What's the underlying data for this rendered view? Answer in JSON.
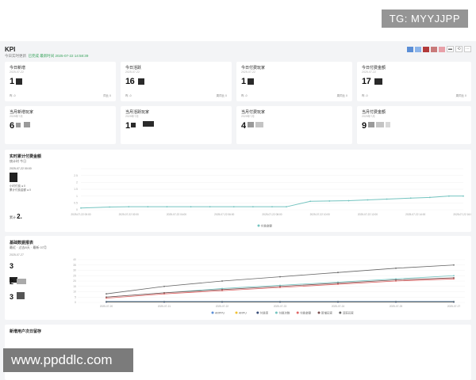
{
  "watermarks": {
    "telegram": "TG: MYYJJPP",
    "site": "www.ppddlc.com"
  },
  "header": {
    "title": "KPI",
    "subtitle_prefix": "今日实时更新",
    "status": "已完成",
    "updated_label": "最新时间 2025-07-22 14:58:39",
    "palette": [
      "#5b8ed6",
      "#8bb4ea",
      "#b23a3a",
      "#c97a7a",
      "#e8a0a8"
    ]
  },
  "kpi_cards": [
    {
      "title": "今日新增",
      "date": "2025-07-22",
      "value": "1",
      "foot_left": "昨 -0",
      "foot_right": "同比 0"
    },
    {
      "title": "今日活跃",
      "date": "2025-07-22",
      "value": "16",
      "foot_left": "昨 -0",
      "foot_right": "周同比 0"
    },
    {
      "title": "今日付费玩家",
      "date": "2025-07-22",
      "value": "1",
      "foot_left": "昨 -0",
      "foot_right": "周同比 0"
    },
    {
      "title": "今日付费金额",
      "date": "2025-07-22",
      "value": "17",
      "foot_left": "昨 -0",
      "foot_right": "周同比 0"
    },
    {
      "title": "当月新增玩家",
      "date": "2025年7月",
      "value": "6",
      "foot_left": "",
      "foot_right": ""
    },
    {
      "title": "当月活跃玩家",
      "date": "2025年7月",
      "value": "1",
      "foot_left": "",
      "foot_right": ""
    },
    {
      "title": "当月付费玩家",
      "date": "2025年7月",
      "value": "4",
      "foot_left": "",
      "foot_right": ""
    },
    {
      "title": "当月付费金额",
      "date": "2025年7月",
      "value": "9",
      "foot_left": "",
      "foot_right": ""
    }
  ],
  "realtime_panel": {
    "title": "实时累计付费金额",
    "filter": "统计时   今日",
    "tooltip_time": "2025-07-22 00:00",
    "tooltip_rows": [
      "小时付费  ● 0",
      "累计付费金额  ● 0"
    ],
    "total_label": "累计",
    "total_value": "2."
  },
  "basic_panel": {
    "title": "基础数据报表",
    "filter": "最近 · 过去8天  ·  最新 07月",
    "side_date": "2025-07-27",
    "side_values": [
      "3",
      "2",
      "3"
    ]
  },
  "bottom_panel": {
    "title": "新增用户次日留存"
  },
  "chart_data": [
    {
      "type": "line",
      "title": "实时累计付费金额",
      "x": [
        "2025-07-22 00:00",
        "2025-07-22 02:00",
        "2025-07-22 04:00",
        "2025-07-22 06:00",
        "2025-07-22 08:00",
        "2025-07-22 10:00",
        "2025-07-22 12:00",
        "2025-07-22 14:00",
        "2025-07-22 16:00"
      ],
      "y_ticks": [
        "",
        "2.5",
        "2",
        "1.5",
        "1",
        "0.5",
        "0"
      ],
      "ylim": [
        0,
        3
      ],
      "series": [
        {
          "name": "付费金额",
          "color": "#74c4c0",
          "points": [
            [
              0,
              0.13
            ],
            [
              0.6,
              0.2
            ],
            [
              1.0,
              0.22
            ],
            [
              1.4,
              0.22
            ],
            [
              1.8,
              0.22
            ],
            [
              2.3,
              0.22
            ],
            [
              2.7,
              0.22
            ],
            [
              3.2,
              0.22
            ],
            [
              3.6,
              0.22
            ],
            [
              4.0,
              0.22
            ],
            [
              4.3,
              0.22
            ],
            [
              4.8,
              0.62
            ],
            [
              5.2,
              0.64
            ],
            [
              5.6,
              0.66
            ],
            [
              6.0,
              0.72
            ],
            [
              6.4,
              0.78
            ],
            [
              6.9,
              0.85
            ],
            [
              7.3,
              0.9
            ],
            [
              7.7,
              1.0
            ],
            [
              8.0,
              1.0
            ]
          ]
        }
      ],
      "legend": [
        "付费金额"
      ]
    },
    {
      "type": "line",
      "title": "基础数据报表",
      "x": [
        "2025-07-20",
        "2025-07-21",
        "2025-07-22",
        "2025-07-23",
        "2025-07-24",
        "2025-07-25",
        "2025-07-27"
      ],
      "y_ticks": [
        "40",
        "35",
        "30",
        "25",
        "20",
        "15",
        "10",
        "5",
        "0"
      ],
      "ylim": [
        0,
        40
      ],
      "series": [
        {
          "name": "ARPPU",
          "color": "#5b8ed6",
          "values": [
            1,
            1,
            1,
            1,
            1,
            1,
            1
          ]
        },
        {
          "name": "ARPU",
          "color": "#f1c232",
          "values": [
            0.5,
            0.5,
            0.5,
            0.5,
            0.5,
            0.5,
            0.5
          ]
        },
        {
          "name": "付费率",
          "color": "#3a4f7a",
          "values": [
            0.3,
            0.3,
            0.3,
            0.3,
            0.3,
            0.3,
            0.3
          ]
        },
        {
          "name": "付费次数",
          "color": "#74c4c0",
          "values": [
            5,
            9,
            13,
            16,
            19,
            22,
            25
          ]
        },
        {
          "name": "付费金额",
          "color": "#e06666",
          "values": [
            4,
            8,
            11,
            14,
            17,
            20,
            22
          ]
        },
        {
          "name": "新增玩家",
          "color": "#7a4f4f",
          "values": [
            5,
            9,
            12,
            15,
            18,
            21,
            23
          ]
        },
        {
          "name": "活跃玩家",
          "color": "#666666",
          "values": [
            8,
            15,
            20,
            24,
            28,
            32,
            35
          ]
        }
      ],
      "legend": [
        "ARPPU",
        "ARPU",
        "付费率",
        "付费次数",
        "付费金额",
        "新增玩家",
        "活跃玩家"
      ]
    }
  ]
}
